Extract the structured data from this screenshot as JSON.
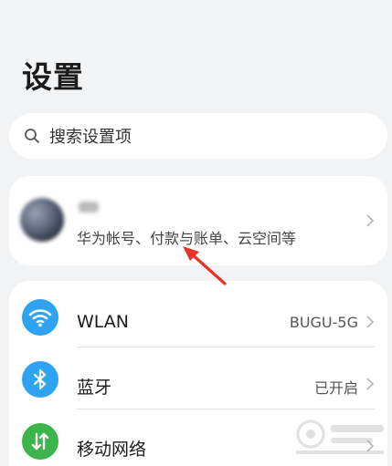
{
  "page": {
    "title": "设置"
  },
  "search": {
    "placeholder": "搜索设置项",
    "icon": "search-icon"
  },
  "account": {
    "subtitle": "华为帐号、付款与账单、云空间等",
    "name_blurred": true
  },
  "settings_items": [
    {
      "label": "WLAN",
      "value": "BUGU-5G",
      "icon": "wifi-icon",
      "color": "#2ea3f2"
    },
    {
      "label": "蓝牙",
      "value": "已开启",
      "icon": "bluetooth-icon",
      "color": "#2ea3f2"
    },
    {
      "label": "移动网络",
      "value": "",
      "icon": "mobile-network-icon",
      "color": "#3cb44b"
    }
  ],
  "annotation": {
    "arrow_color": "#e8332a"
  }
}
